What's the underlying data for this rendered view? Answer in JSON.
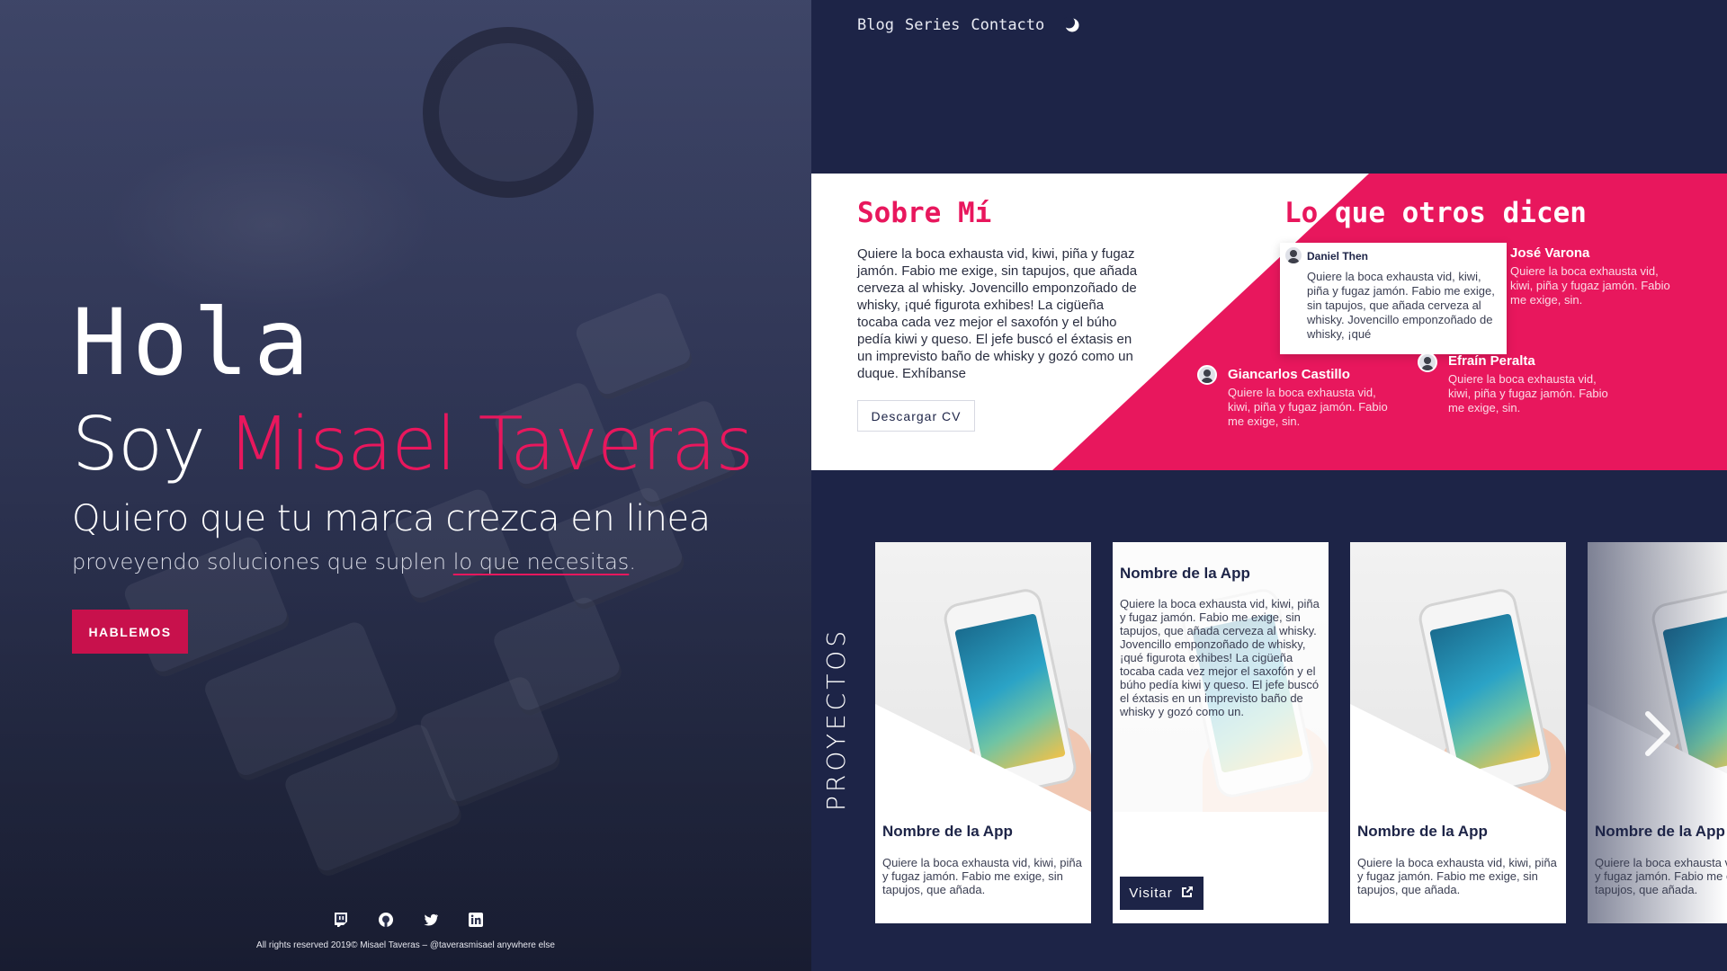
{
  "nav": {
    "items": [
      "Blog",
      "Series",
      "Contacto"
    ],
    "theme_icon": "moon-icon"
  },
  "hero": {
    "greeting": "Hola",
    "intro": "Soy",
    "name": "Misael Taveras",
    "tagline": "Quiero que tu marca crezca en linea",
    "subtitle_pre": "proveyendo soluciones que suplen ",
    "subtitle_link": "lo que necesitas",
    "subtitle_post": ".",
    "cta": "HABLEMOS"
  },
  "social": [
    "twitch-icon",
    "github-icon",
    "twitter-icon",
    "linkedin-icon"
  ],
  "footer": {
    "copyright": "All rights reserved 2019© Misael Taveras – @taverasmisael anywhere else"
  },
  "about": {
    "title": "Sobre Mí",
    "text": "Quiere la boca exhausta vid, kiwi, piña y fugaz jamón. Fabio me exige, sin tapujos, que añada cerveza al whisky. Jovencillo emponzoñado de whisky, ¡qué figurota exhibes! La cigüeña tocaba cada vez mejor el saxofón y el búho pedía kiwi y queso. El jefe buscó el éxtasis en un imprevisto baño de whisky y gozó como un duque. Exhíbanse",
    "cv_button": "Descargar CV"
  },
  "testimonials": {
    "title_first": "Lo",
    "title_rest": " que otros dicen",
    "featured": {
      "name": "Daniel Then",
      "text": "Quiere la boca exhausta vid, kiwi, piña y fugaz jamón. Fabio me exige, sin tapujos, que añada cerveza al whisky. Jovencillo emponzoñado de whisky, ¡qué"
    },
    "others": [
      {
        "name": "José Varona",
        "text": "Quiere la boca exhausta vid, kiwi, piña y fugaz jamón. Fabio me exige, sin."
      },
      {
        "name": "Giancarlos Castillo",
        "text": "Quiere la boca exhausta vid, kiwi, piña y fugaz jamón. Fabio me exige, sin."
      },
      {
        "name": "Efraín Peralta",
        "text": "Quiere la boca exhausta vid, kiwi, piña y fugaz jamón. Fabio me exige, sin."
      }
    ]
  },
  "projects": {
    "label": "PROYECTOS",
    "cards": [
      {
        "title": "Nombre de la App",
        "text": "Quiere la boca exhausta vid, kiwi, piña y fugaz jamón. Fabio me exige, sin tapujos, que añada."
      },
      {
        "title": "Nombre de la App",
        "text": "Quiere la boca exhausta vid, kiwi, piña y fugaz jamón. Fabio me exige, sin tapujos, que añada cerveza al whisky. Jovencillo emponzoñado de whisky, ¡qué figurota exhibes! La cigüeña tocaba cada vez mejor el saxofón y el búho pedía kiwi y queso. El jefe buscó el éxtasis en un imprevisto baño de whisky y gozó como un.",
        "button": "Visitar"
      },
      {
        "title": "Nombre de la App",
        "text": "Quiere la boca exhausta vid, kiwi, piña y fugaz jamón. Fabio me exige, sin tapujos, que añada."
      },
      {
        "title": "Nombre de la App",
        "text": "Quiere la boca exhausta vid, kiwi, piña y fugaz jamón. Fabio me exige, sin tapujos, que añada."
      }
    ],
    "next_icon": "chevron-right-icon"
  },
  "colors": {
    "navy": "#1d2447",
    "pink": "#e8175d",
    "white": "#ffffff"
  }
}
